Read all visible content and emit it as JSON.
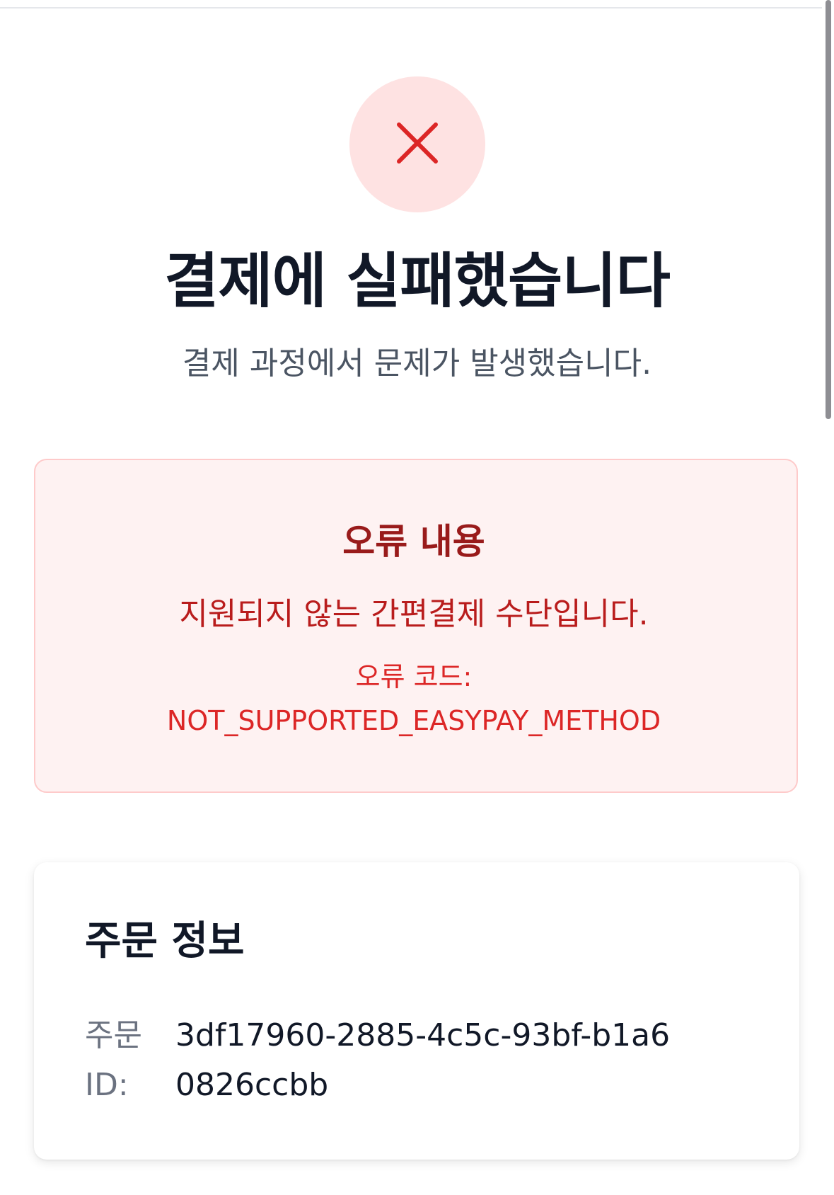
{
  "status": {
    "icon": "close-icon",
    "title": "결제에 실패했습니다",
    "subtitle": "결제 과정에서 문제가 발생했습니다."
  },
  "error": {
    "heading": "오류 내용",
    "message": "지원되지 않는 간편결제 수단입니다.",
    "code_label": "오류 코드:",
    "code_value": "NOT_SUPPORTED_EASYPAY_METHOD"
  },
  "order": {
    "heading": "주문 정보",
    "id_label": "주문 ID:",
    "id_value": "3df17960-2885-4c5c-93bf-b1a60826ccbb"
  },
  "colors": {
    "badge_bg": "#fee2e2",
    "icon": "#dc2626",
    "error_bg": "#fef2f2",
    "error_border": "#fecaca"
  }
}
